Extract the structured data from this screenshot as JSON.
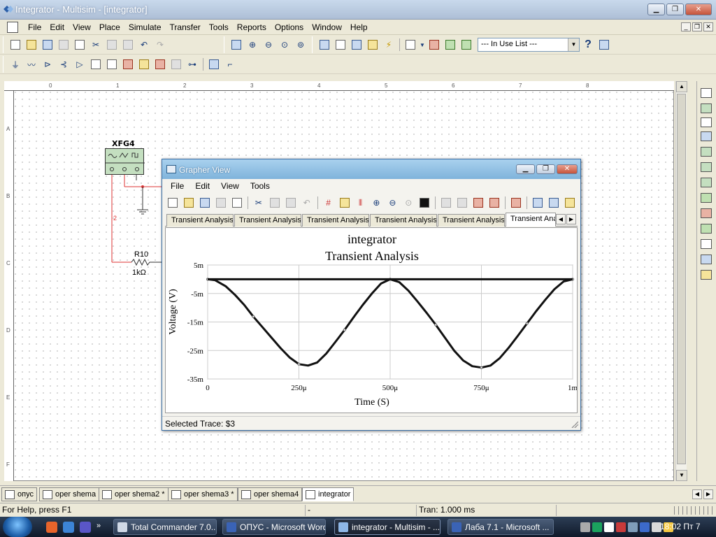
{
  "window": {
    "title": "Integrator - Multisim - [integrator]"
  },
  "menu": [
    "File",
    "Edit",
    "View",
    "Place",
    "Simulate",
    "Transfer",
    "Tools",
    "Reports",
    "Options",
    "Window",
    "Help"
  ],
  "toolbar": {
    "in_use_list": "--- In Use List ---"
  },
  "schematic": {
    "generator_label": "XFG4",
    "resistor_name": "R10",
    "resistor_value": "1kΩ",
    "wire_label": "2"
  },
  "ruler": {
    "top": [
      "0",
      "1",
      "2",
      "3",
      "4",
      "5",
      "6",
      "7",
      "8"
    ],
    "left": [
      "A",
      "B",
      "C",
      "D",
      "E",
      "F"
    ]
  },
  "grapher": {
    "title": "Grapher View",
    "menu": [
      "File",
      "Edit",
      "View",
      "Tools"
    ],
    "tabs": [
      "Transient Analysis",
      "Transient Analysis",
      "Transient Analysis",
      "Transient Analysis",
      "Transient Analysis",
      "Transient Ana"
    ],
    "status": "Selected Trace:  $3"
  },
  "chart_data": {
    "type": "line",
    "title": "integrator",
    "subtitle": "Transient Analysis",
    "xlabel": "Time (S)",
    "ylabel": "Voltage (V)",
    "xlim": [
      0,
      0.001
    ],
    "ylim": [
      -0.035,
      0.005
    ],
    "xticks": [
      0,
      0.00025,
      0.0005,
      0.00075,
      0.001
    ],
    "xtick_labels": [
      "0",
      "250μ",
      "500μ",
      "750μ",
      "1m"
    ],
    "yticks": [
      0.005,
      -0.005,
      -0.015,
      -0.025,
      -0.035
    ],
    "ytick_labels": [
      "5m",
      "-5m",
      "-15m",
      "-25m",
      "-35m"
    ],
    "grid": true,
    "series": [
      {
        "x": [
          0,
          2e-05,
          5e-05,
          7.5e-05,
          0.0001,
          0.000125,
          0.00015,
          0.000175,
          0.0002,
          0.000225,
          0.00025,
          0.000275,
          0.0003,
          0.000325,
          0.00035,
          0.000375,
          0.0004,
          0.000425,
          0.00045,
          0.000475,
          0.0005,
          0.000525,
          0.00055,
          0.000575,
          0.0006,
          0.000625,
          0.00065,
          0.000675,
          0.0007,
          0.000725,
          0.00075,
          0.000775,
          0.0008,
          0.000825,
          0.00085,
          0.000875,
          0.0009,
          0.000925,
          0.00095,
          0.000975,
          0.001
        ],
        "y": [
          0,
          -0.0003,
          -0.0025,
          -0.0055,
          -0.009,
          -0.0131,
          -0.0168,
          -0.0205,
          -0.0242,
          -0.0275,
          -0.0298,
          -0.0303,
          -0.0292,
          -0.0261,
          -0.022,
          -0.0178,
          -0.0133,
          -0.009,
          -0.005,
          -0.0015,
          0,
          -0.001,
          -0.004,
          -0.0078,
          -0.0118,
          -0.016,
          -0.0205,
          -0.025,
          -0.0285,
          -0.0305,
          -0.031,
          -0.0303,
          -0.0277,
          -0.024,
          -0.0198,
          -0.0155,
          -0.0112,
          -0.0072,
          -0.0035,
          -0.0008,
          0
        ]
      },
      {
        "x": [
          0,
          0.001
        ],
        "y": [
          0,
          0
        ]
      }
    ]
  }
}
